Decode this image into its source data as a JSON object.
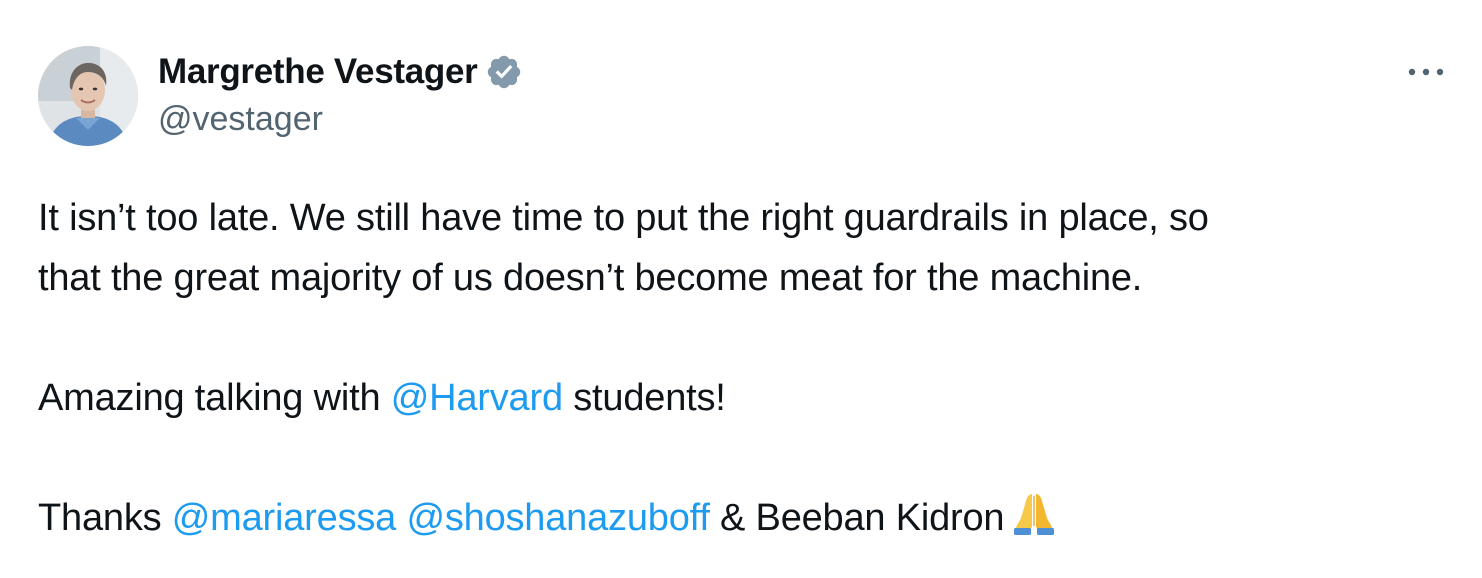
{
  "author": {
    "display_name": "Margrethe Vestager",
    "handle": "@vestager",
    "verified_icon": "verified-badge-icon",
    "verified_color": "#829aab"
  },
  "menu": {
    "more_label": "•••"
  },
  "tweet": {
    "line1": "It isn’t too late. We still have time to put the right guardrails in place, so",
    "line2": "that the great majority of us doesn’t become meat for the machine.",
    "line3_prefix": "Amazing talking with ",
    "line3_mention": "@Harvard",
    "line3_suffix": " students!",
    "line4_prefix": "Thanks ",
    "line4_mention1": "@mariaressa",
    "line4_mention2": "@shoshanazuboff",
    "line4_suffix": " & Beeban Kidron",
    "emoji": "folded-hands-emoji"
  },
  "colors": {
    "text": "#0f1419",
    "secondary": "#536471",
    "link": "#1d9bf0"
  }
}
